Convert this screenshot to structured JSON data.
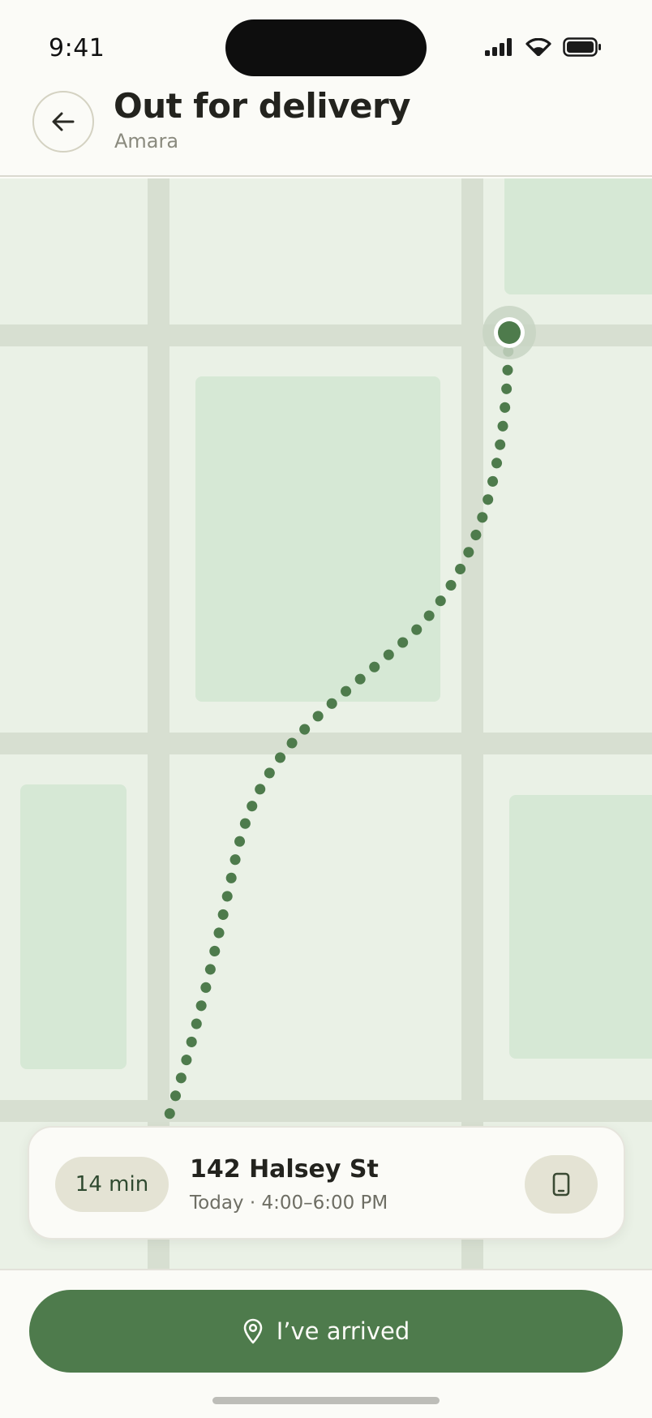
{
  "status_bar": {
    "time": "9:41"
  },
  "header": {
    "title": "Out for delivery",
    "subtitle": "Amara"
  },
  "delivery": {
    "eta": "14 min",
    "address": "142 Halsey St",
    "window": "Today · 4:00–6:00 PM"
  },
  "actions": {
    "arrived_label": "I’ve arrived"
  },
  "colors": {
    "accent": "#4E7B4C",
    "map_bg": "#EAF1E6",
    "road": "#D7DFD1",
    "park": "#D6E8D5"
  },
  "icons": {
    "back": "arrow-left-icon",
    "call": "phone-icon",
    "arrived": "location-pin-icon"
  }
}
